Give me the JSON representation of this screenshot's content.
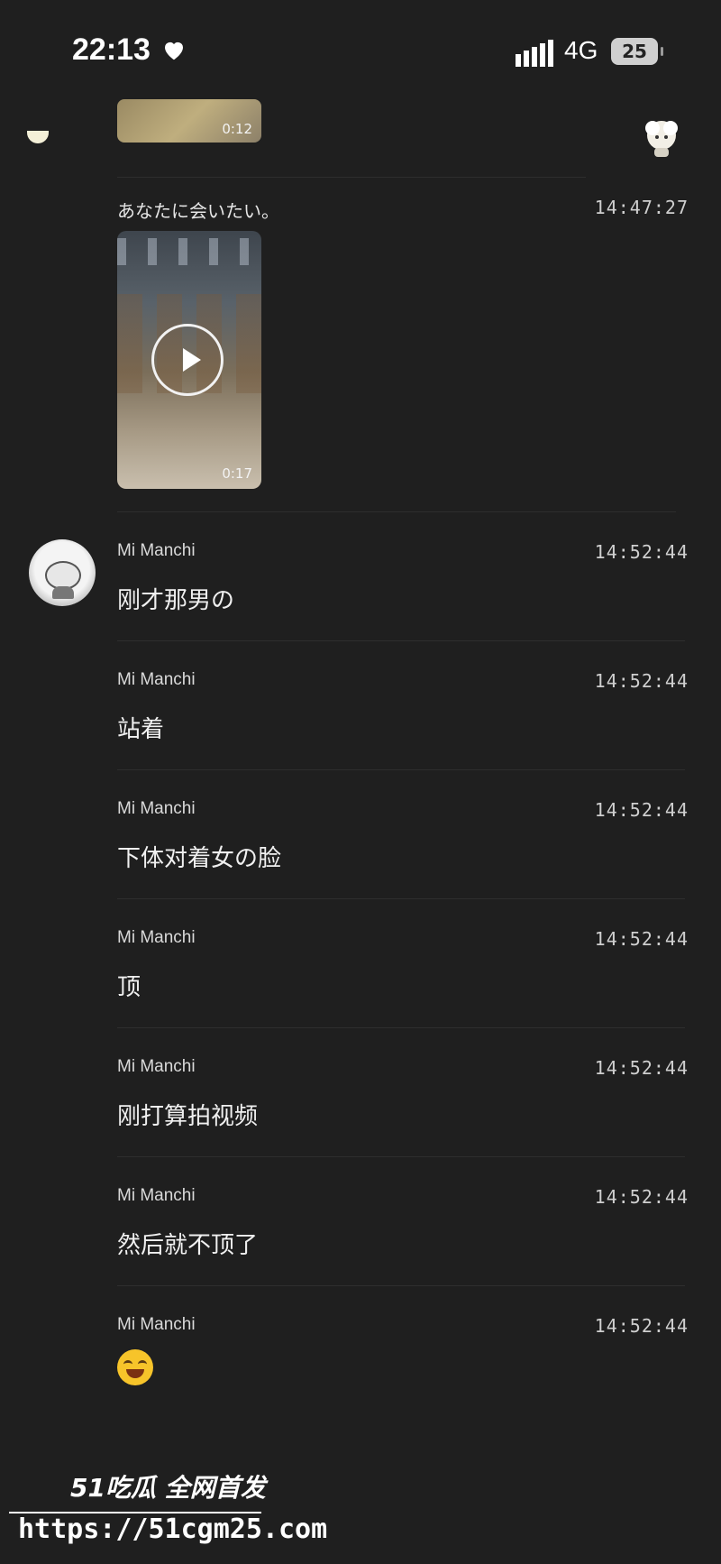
{
  "status_bar": {
    "time": "22:13",
    "network": "4G",
    "battery": "25"
  },
  "top_video": {
    "duration": "0:12"
  },
  "chat": [
    {
      "type": "video",
      "text": "あなたに会いたい。",
      "time": "14:47:27",
      "duration": "0:17"
    },
    {
      "sender": "Mi Manchi",
      "text": "刚才那男の",
      "time": "14:52:44"
    },
    {
      "sender": "Mi Manchi",
      "text": "站着",
      "time": "14:52:44"
    },
    {
      "sender": "Mi Manchi",
      "text": "下体对着女の脸",
      "time": "14:52:44"
    },
    {
      "sender": "Mi Manchi",
      "text": "顶",
      "time": "14:52:44"
    },
    {
      "sender": "Mi Manchi",
      "text": "刚打算拍视频",
      "time": "14:52:44"
    },
    {
      "sender": "Mi Manchi",
      "text": "然后就不顶了",
      "time": "14:52:44"
    },
    {
      "sender": "Mi Manchi",
      "emoji": "laughing-tears-emoji",
      "time": "14:52:44"
    }
  ],
  "watermark": {
    "brand": "51吃瓜 全网首发",
    "url": "https://51cgm25.com"
  }
}
